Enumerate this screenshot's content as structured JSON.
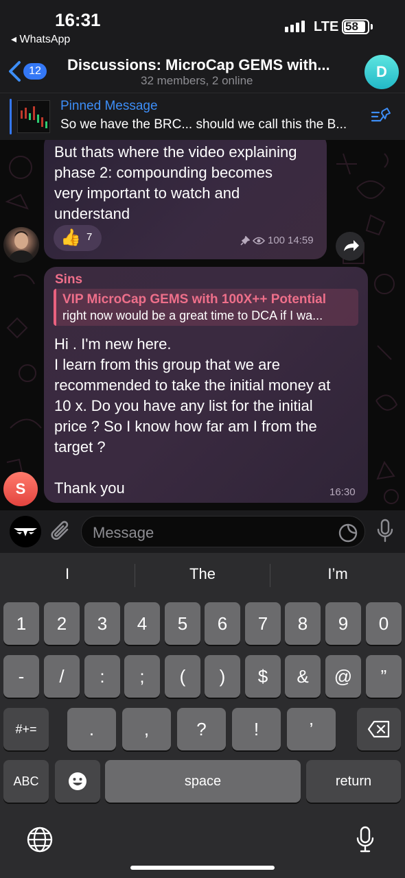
{
  "status_bar": {
    "time": "16:31",
    "back_app": "◂ WhatsApp",
    "network": "LTE",
    "battery": "58"
  },
  "header": {
    "back_count": "12",
    "title": "Discussions: MicroCap GEMS with...",
    "subtitle": "32 members, 2 online",
    "avatar_letter": "D"
  },
  "pinned": {
    "title": "Pinned Message",
    "text": "So we have the BRC... should we call this the B..."
  },
  "messages": [
    {
      "lines": [
        "But thats where the video explaining",
        "phase 2: compounding becomes",
        "very important to watch and",
        "understand"
      ],
      "reaction_emoji": "👍",
      "reaction_count": "7",
      "views": "100",
      "time": "14:59"
    },
    {
      "sender": "Sins",
      "reply_title": "VIP MicroCap GEMS with 100X++ Potential",
      "reply_text": "right now would be a great time to DCA if I wa...",
      "lines": [
        "Hi . I'm new here.",
        "I learn from this group that we are",
        "recommended to take the initial money at",
        "10 x. Do you have any list for the initial",
        "price ? So I know how far am I from the",
        "target ?",
        "",
        "Thank you"
      ],
      "time": "16:30",
      "avatar_letter": "S"
    }
  ],
  "input": {
    "placeholder": "Message"
  },
  "keyboard": {
    "suggestions": [
      "I",
      "The",
      "I’m"
    ],
    "row1": [
      "1",
      "2",
      "3",
      "4",
      "5",
      "6",
      "7",
      "8",
      "9",
      "0"
    ],
    "row2": [
      "-",
      "/",
      ":",
      ";",
      "(",
      ")",
      "$",
      "&",
      "@",
      "”"
    ],
    "row3_mode": "#+=",
    "row3": [
      ".",
      ",",
      "?",
      "!",
      "’"
    ],
    "abc": "ABC",
    "space": "space",
    "return": "return"
  }
}
